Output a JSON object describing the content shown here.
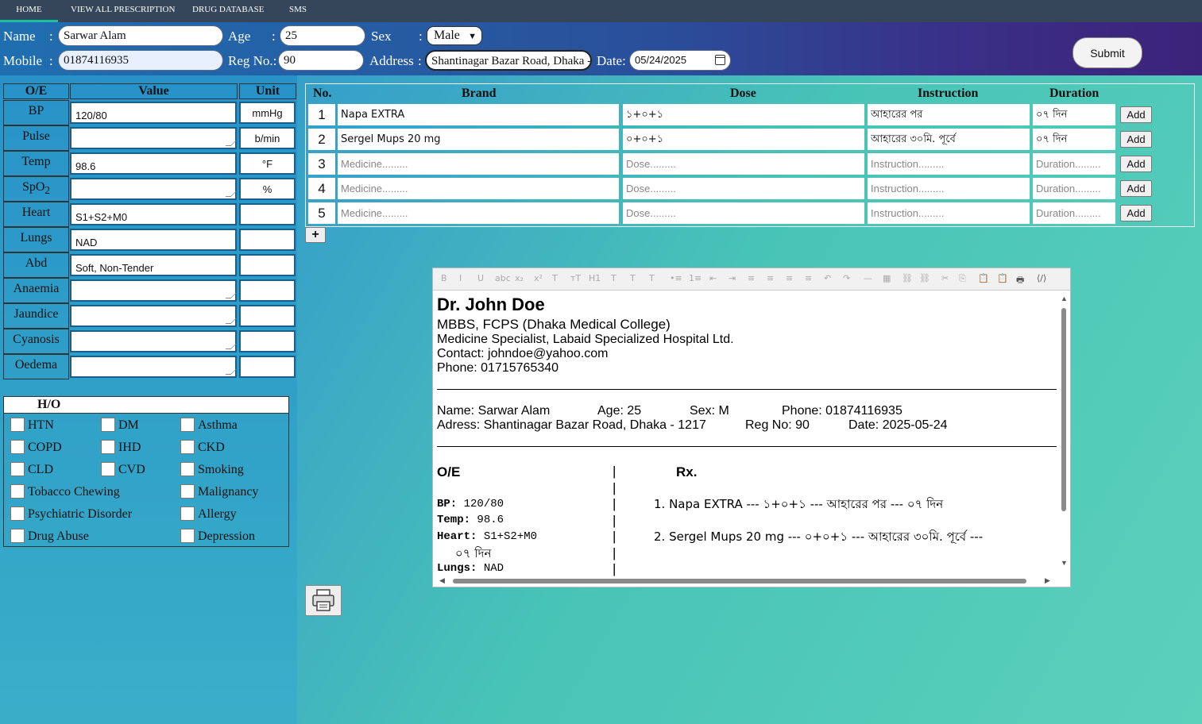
{
  "nav": {
    "items": [
      "HOME",
      "VIEW ALL PRESCRIPTION",
      "DRUG DATABASE",
      "SMS"
    ]
  },
  "patient": {
    "name_label": "Name",
    "name": "Sarwar Alam",
    "age_label": "Age",
    "age": "25",
    "sex_label": "Sex",
    "sex": "Male",
    "mobile_label": "Mobile",
    "mobile": "01874116935",
    "reg_label": "Reg No.:",
    "reg": "90",
    "address_label": "Address",
    "address": "Shantinagar Bazar Road, Dhaka - 1217",
    "date_label": "Date:",
    "date": "05/24/2025",
    "submit": "Submit"
  },
  "oe": {
    "headers": [
      "O/E",
      "Value",
      "Unit"
    ],
    "rows": [
      {
        "name": "BP",
        "value": "120/80",
        "unit": "mmHg"
      },
      {
        "name": "Pulse",
        "value": "",
        "unit": "b/min"
      },
      {
        "name": "Temp",
        "value": "98.6",
        "unit": "°F"
      },
      {
        "name": "SpO",
        "sub": "2",
        "value": "",
        "unit": "%"
      },
      {
        "name": "Heart",
        "value": "S1+S2+M0",
        "unit": ""
      },
      {
        "name": "Lungs",
        "value": "NAD",
        "unit": ""
      },
      {
        "name": "Abd",
        "value": "Soft, Non-Tender",
        "unit": ""
      },
      {
        "name": "Anaemia",
        "value": "",
        "unit": ""
      },
      {
        "name": "Jaundice",
        "value": "",
        "unit": ""
      },
      {
        "name": "Cyanosis",
        "value": "",
        "unit": ""
      },
      {
        "name": "Oedema",
        "value": "",
        "unit": ""
      }
    ]
  },
  "ho": {
    "title": "H/O",
    "items": [
      "HTN",
      "DM",
      "Asthma",
      "COPD",
      "IHD",
      "CKD",
      "CLD",
      "CVD",
      "Smoking",
      "Tobacco Chewing",
      "Malignancy",
      "Psychiatric Disorder",
      "Allergy",
      "Drug Abuse",
      "Depression"
    ]
  },
  "rx_table": {
    "headers": [
      "No.",
      "Brand",
      "Dose",
      "Instruction",
      "Duration"
    ],
    "add_label": "Add",
    "plus": "+",
    "rows": [
      {
        "no": "1",
        "brand": "Napa   EXTRA",
        "dose": "১+০+১",
        "instruction": "আহারের পর",
        "duration": "০৭ দিন"
      },
      {
        "no": "2",
        "brand": "Sergel Mups 20 mg",
        "dose": "০+০+১",
        "instruction": "আহারের ৩০মি. পূর্বে",
        "duration": "০৭ দিন"
      },
      {
        "no": "3",
        "brand": "Medicine.........",
        "dose": "Dose.........",
        "instruction": "Instruction.........",
        "duration": "Duration........."
      },
      {
        "no": "4",
        "brand": "Medicine.........",
        "dose": "Dose.........",
        "instruction": "Instruction.........",
        "duration": "Duration........."
      },
      {
        "no": "5",
        "brand": "Medicine.........",
        "dose": "Dose.........",
        "instruction": "Instruction.........",
        "duration": "Duration........."
      }
    ]
  },
  "editor": {
    "toolbar": [
      "B",
      "I",
      "U",
      "abc",
      "x₂",
      "x²",
      "T",
      "тT",
      "H1",
      "T",
      "T",
      "T",
      "•≡",
      "1≡",
      "⇤",
      "⇥",
      "≡",
      "≡",
      "≡",
      "≡",
      "↶",
      "↷",
      "—",
      "▦",
      "⛓",
      "⛓",
      "✂",
      "⎘",
      "📋",
      "📋",
      "🖶",
      "⟨/⟩"
    ],
    "doctor_name": "Dr. John Doe",
    "degree": "MBBS, FCPS (Dhaka Medical College)",
    "specialty": "Medicine Specialist, Labaid Specialized Hospital Ltd.",
    "contact": "Contact: johndoe@yahoo.com",
    "phone": "Phone: 01715765340",
    "p_name": "Name: Sarwar Alam",
    "p_age": "Age: 25",
    "p_sex": "Sex: M",
    "p_phone": "Phone: 01874116935",
    "p_address": "Adress: Shantinagar Bazar Road, Dhaka - 1217",
    "p_reg": "Reg No: 90",
    "p_date": "Date: 2025-05-24",
    "oe_title": "O/E",
    "rx_title": "Rx.",
    "oe_lines": [
      {
        "k": "BP:",
        "v": "120/80"
      },
      {
        "k": "Temp:",
        "v": "98.6"
      },
      {
        "k": "Heart:",
        "v": "S1+S2+M0"
      },
      {
        "k": "Lungs:",
        "v": "NAD"
      }
    ],
    "rx_line1": "1. Napa EXTRA    ---    ১+০+১    ---    আহারের পর    ---    ০৭ দিন",
    "rx_line2": "2. Sergel Mups 20 mg    ---    ০+০+১    ---    আহারের ৩০মি. পূর্বে    ---",
    "rx_line2b": "০৭ দিন"
  },
  "icons": {
    "print": "print-icon"
  }
}
